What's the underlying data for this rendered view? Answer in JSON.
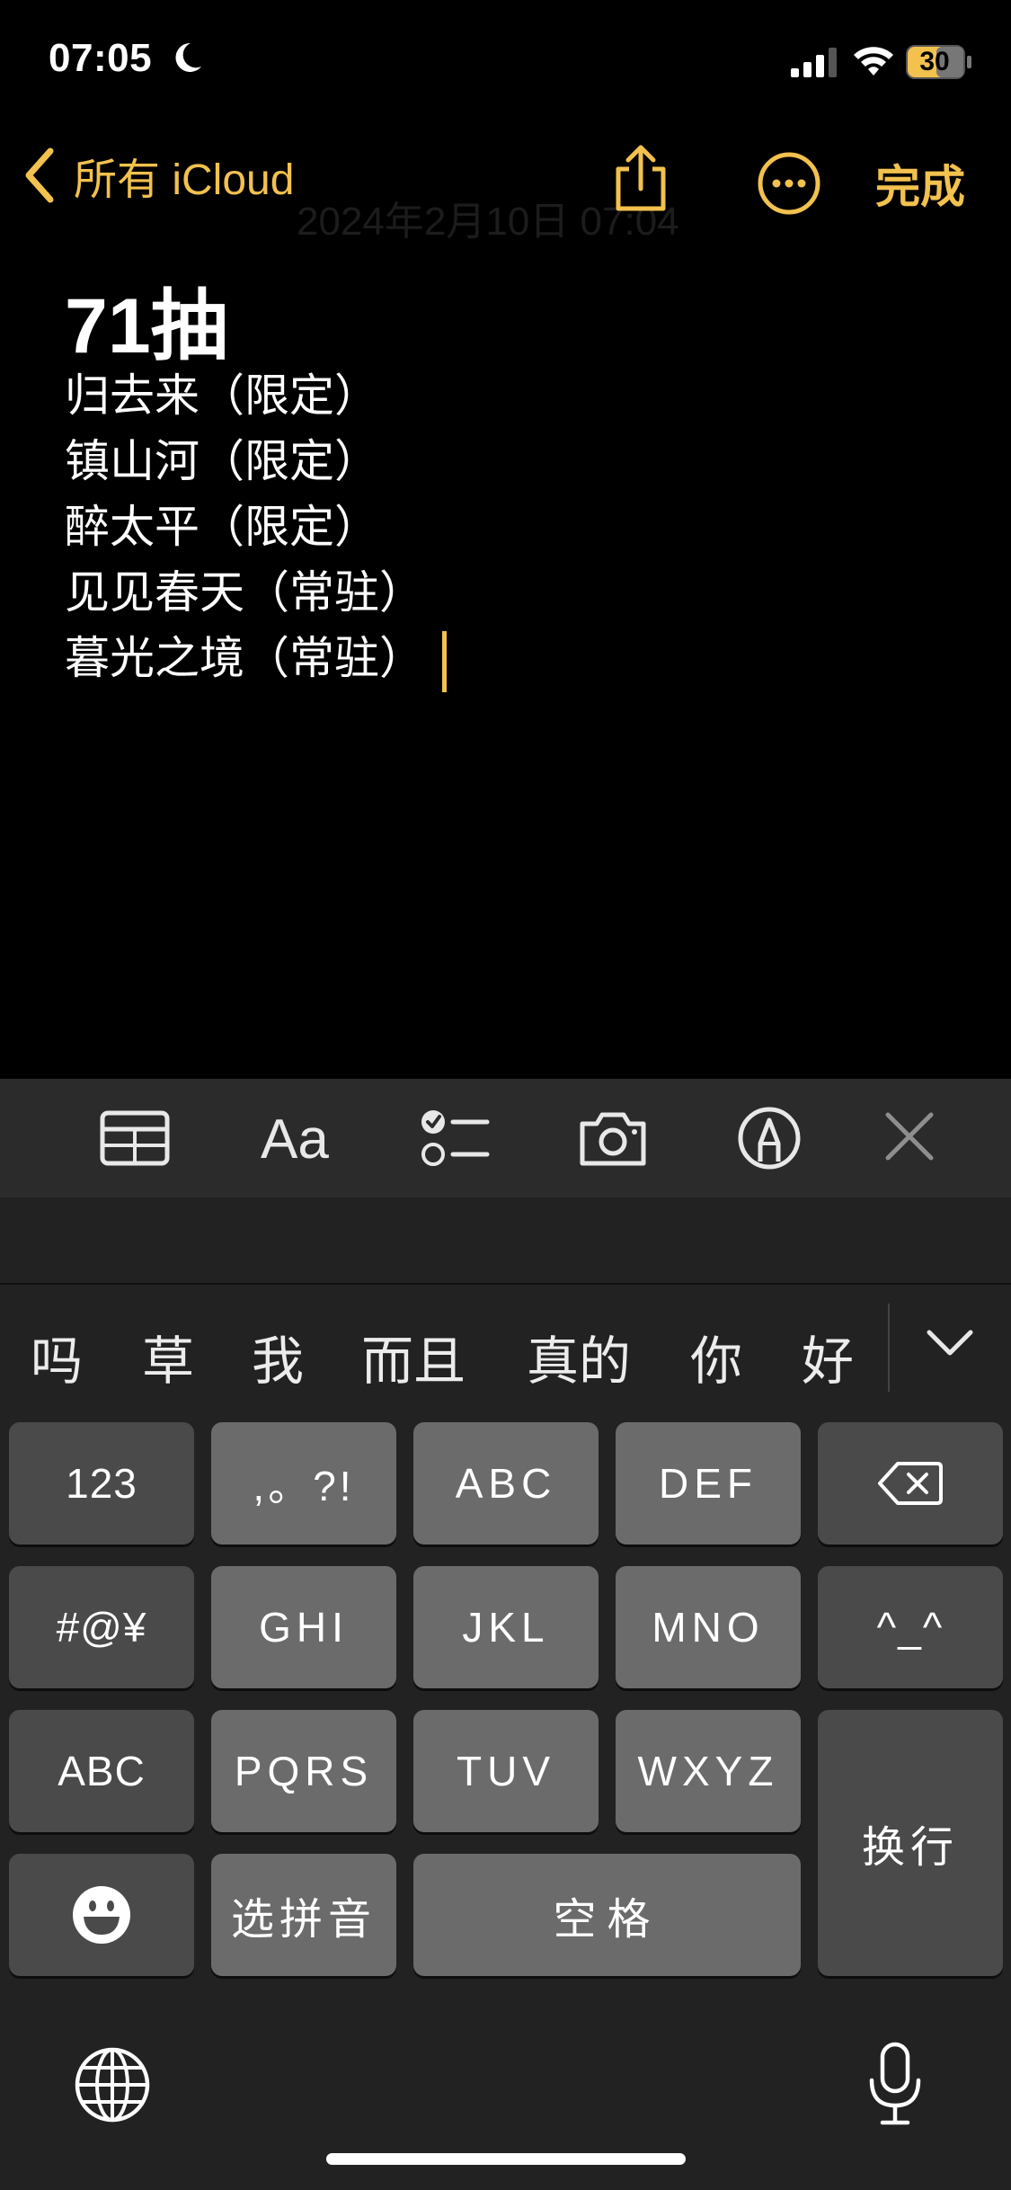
{
  "status_bar": {
    "time": "07:05",
    "battery": "30"
  },
  "nav": {
    "back_label": "所有 iCloud",
    "done_label": "完成",
    "date_text": "2024年2月10日 07:04"
  },
  "note": {
    "title": "71抽",
    "lines": [
      "归去来（限定）",
      "镇山河（限定）",
      "醉太平（限定）",
      "见见春天（常驻）",
      "暮光之境（常驻）"
    ]
  },
  "toolbar": {
    "format_label": "Aa"
  },
  "candidates": [
    "吗",
    "草",
    "我",
    "而且",
    "真的",
    "你",
    "好"
  ],
  "keyboard": {
    "row1": [
      "123",
      ",。?!",
      "ABC",
      "DEF"
    ],
    "row2": [
      "#@¥",
      "GHI",
      "JKL",
      "MNO",
      "^_^"
    ],
    "row3": [
      "ABC",
      "PQRS",
      "TUV",
      "WXYZ"
    ],
    "row4": [
      "选拼音",
      "空格"
    ],
    "return_label": "换行"
  },
  "colors": {
    "accent": "#f2c14e",
    "background": "#000000",
    "keyboard_bg": "#222222"
  }
}
